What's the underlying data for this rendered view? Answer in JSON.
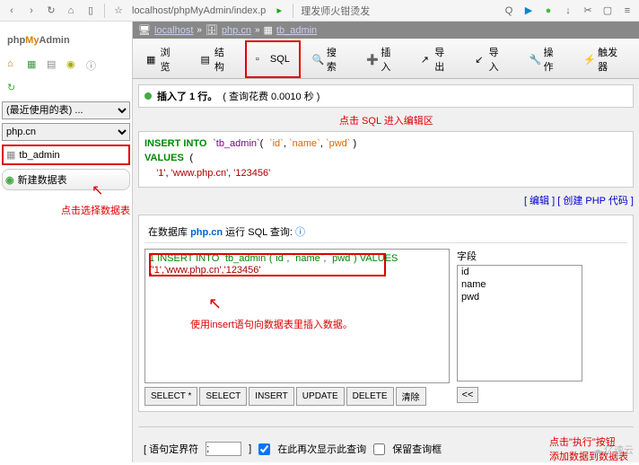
{
  "browser": {
    "address": "localhost/phpMyAdmin/index.p",
    "tab_title": "理发师火钳烫发"
  },
  "logo": {
    "p1": "php",
    "p2": "My",
    "p3": "Admin"
  },
  "sidebar": {
    "recent_label": "(最近使用的表) ...",
    "db_label": "php.cn",
    "table": "tb_admin",
    "new_table": "新建数据表",
    "anno": "点击选择数据表"
  },
  "crumb": {
    "host": "localhost",
    "db": "php.cn",
    "tbl": "tb_admin"
  },
  "tabs": {
    "browse": "浏览",
    "structure": "结构",
    "sql": "SQL",
    "search": "搜索",
    "insert": "插入",
    "export": "导出",
    "import": "导入",
    "operations": "操作",
    "triggers": "触发器"
  },
  "anno_sql": "点击 SQL 进入编辑区",
  "msg": {
    "text": "插入了 1 行。",
    "time": "( 查询花费 0.0010 秒 )"
  },
  "code": {
    "l1a": "INSERT INTO",
    "l1b": "`tb_admin`",
    "l1c": "(",
    "l1d": "`id`",
    "l1e": ", ",
    "l1f": "`name`",
    "l1g": ", ",
    "l1h": "`pwd`",
    "l1i": " )",
    "l2": "VALUES",
    "l2b": "(",
    "l3a": "'1'",
    "l3b": ", ",
    "l3c": "'www.php.cn'",
    "l3d": ", ",
    "l3e": "'123456'"
  },
  "links": {
    "edit": "[ 编辑 ]",
    "php": "[ 创建 PHP 代码 ]"
  },
  "panel": {
    "pre": "在数据库 ",
    "db": "php.cn",
    "post": " 运行 SQL 查询:"
  },
  "editor": {
    "line1": "1 INSERT INTO `tb_admin`(`id`, `name`, `pwd`) VALUES",
    "line2": "  ('1','www.php.cn','123456'"
  },
  "anno_insert": "使用insert语句向数据表里插入数据。",
  "fields": {
    "header": "字段",
    "f1": "id",
    "f2": "name",
    "f3": "pwd"
  },
  "btns": {
    "selectall": "SELECT *",
    "select": "SELECT",
    "insert": "INSERT",
    "update": "UPDATE",
    "delete": "DELETE",
    "clear": "清除"
  },
  "scroll": "<<",
  "footer": {
    "delim": "[ 语句定界符",
    "delim_val": ";",
    "bracket": "]",
    "show_again": "在此再次显示此查询",
    "retain": "保留查询框"
  },
  "anno_exec1": "点击\"执行\"按钮",
  "anno_exec2": "添加数据到数据表",
  "watermark": "亿速云"
}
